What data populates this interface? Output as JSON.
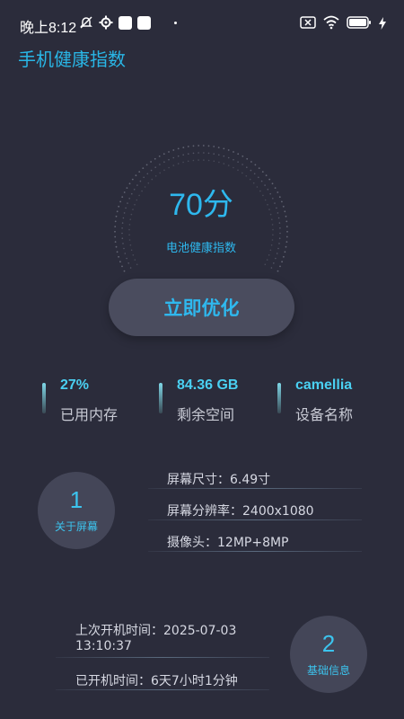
{
  "status_bar": {
    "time": "晚上8:12",
    "left_icons": [
      "notification-muted-icon",
      "settings-icon",
      "app-square-icon",
      "app-square-icon",
      "dot-icon"
    ],
    "right_icons": [
      "sim-off-icon",
      "wifi-icon",
      "battery-icon",
      "charging-icon"
    ]
  },
  "header": {
    "title": "手机健康指数"
  },
  "score": {
    "value": "70分",
    "label": "电池健康指数",
    "color": "#2eb8ee"
  },
  "action": {
    "optimize_label": "立即优化"
  },
  "stats": [
    {
      "value": "27%",
      "label": "已用内存"
    },
    {
      "value": "84.36 GB",
      "label": "剩余空间"
    },
    {
      "value": "camellia",
      "label": "设备名称"
    }
  ],
  "screen_info": {
    "badge_number": "1",
    "badge_label": "关于屏幕",
    "lines": [
      "屏幕尺寸：6.49寸",
      "屏幕分辨率：2400x1080",
      "摄像头：12MP+8MP"
    ]
  },
  "basic_info": {
    "badge_number": "2",
    "badge_label": "基础信息",
    "last_boot_line1": "上次开机时间：2025-07-03",
    "last_boot_line2": "13:10:37",
    "uptime": "已开机时间：6天7小时1分钟"
  }
}
